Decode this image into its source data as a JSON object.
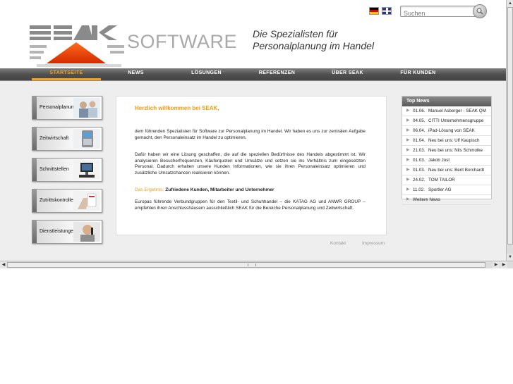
{
  "header": {
    "logo_alt": "SEAK",
    "logo_software": "SOFTWARE",
    "tagline_line1": "Die Spezialisten für",
    "tagline_line2": "Personalplanung im Handel",
    "search_placeholder": "Suchen",
    "flags": [
      "german-flag-icon",
      "uk-flag-icon"
    ]
  },
  "nav": {
    "items": [
      "STARTSEITE",
      "NEWS",
      "LÖSUNGEN",
      "REFERENZEN",
      "ÜBER SEAK",
      "FÜR KUNDEN"
    ],
    "active": "STARTSEITE"
  },
  "sidebar": {
    "tiles": [
      "Personalplanung",
      "Zeitwirtschaft",
      "Schnittstellen",
      "Zutrittskontrolle",
      "Dienstleistungen"
    ]
  },
  "main": {
    "welcome": "Herzlich willkommen bei SEAK,",
    "para1": "dem führenden Spezialisten für Software zur Personalplanung im Handel. Wir haben es uns zur zentralen Aufgabe gemacht, den Personaleinsatz im Handel zu optimieren.",
    "para2": "Dafür haben wir eine Lösung geschaffen, die auf die speziellen Bedürfnisse des Handels abgestimmt ist. Wir analysieren Besucherfrequenzen, Käuferquoten und Umsätze und setzen sie ins Verhältnis zum eingesetzten Personal. Dadurch erhalten unsere Kunden Informationen, wie sie ihren Personaleinsatz optimieren und zusätzliche Umsatzchancen realisieren können.",
    "result_label": "Das Ergebnis:",
    "result_text": "Zufriedene Kunden, Mitarbeiter und Unternehmer",
    "para3": "Europas führende Verbundgruppen für den Textil- und Schuhhandel – die KATAG AG und ANWR GROUP – empfehlen ihren Anschlusshäusern ausschließlich SEAK für die Bereiche Personalplanung und Zeitwirtschaft."
  },
  "footer": {
    "kontakt": "Kontakt",
    "impressum": "Impressum"
  },
  "news": {
    "title": "Top News",
    "items": [
      {
        "date": "01.06.",
        "title": "Manuel Asberger - SEAK QM"
      },
      {
        "date": "04.05.",
        "title": "CITTI Unternehmensgruppe"
      },
      {
        "date": "06.04.",
        "title": "iPad-Lösung von SEAK"
      },
      {
        "date": "01.04.",
        "title": "Neu bei uns: Ulf Kaupisch"
      },
      {
        "date": "21.03.",
        "title": "Neu bei uns: Nils Schmolke"
      },
      {
        "date": "01.03.",
        "title": "Jakob Jost"
      },
      {
        "date": "01.03.",
        "title": "Neu bei uns: Berit Borchardt"
      },
      {
        "date": "24.02.",
        "title": "TOM TAILOR"
      },
      {
        "date": "11.02.",
        "title": "Sportler AG"
      }
    ],
    "more": "Weitere News"
  },
  "colors": {
    "accent": "#f29b12",
    "nav_bg": "#505050",
    "content_bg": "#eeeeee"
  }
}
